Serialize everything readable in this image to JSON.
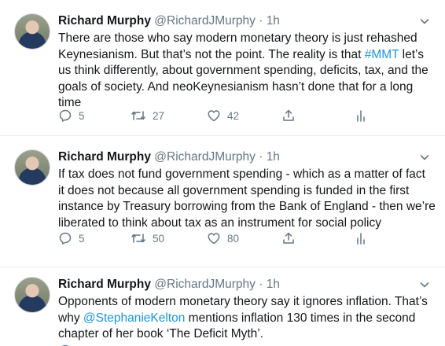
{
  "tweets": [
    {
      "author_name": "Richard Murphy",
      "handle": "@RichardJMurphy",
      "separator": "·",
      "time": "1h",
      "text_lines": [
        [
          {
            "t": "There are those who say modern monetary theory is just rehashed"
          }
        ],
        [
          {
            "t": "Keynesianism. But that’s not the point. The reality is that "
          },
          {
            "t": "#MMT",
            "link": true
          },
          {
            "t": " let’s"
          }
        ],
        [
          {
            "t": "us think differently, about government spending, deficits, tax, and the"
          }
        ],
        [
          {
            "t": "goals of society. And neoKeynesianism hasn’t done that for a long"
          }
        ],
        [
          {
            "t": "time"
          }
        ]
      ],
      "replies": "5",
      "retweets": "27",
      "likes": "42"
    },
    {
      "author_name": "Richard Murphy",
      "handle": "@RichardJMurphy",
      "separator": "·",
      "time": "1h",
      "text_lines": [
        [
          {
            "t": "If tax does not fund government spending - which as a matter of fact"
          }
        ],
        [
          {
            "t": "it does not because all government spending is funded in the first"
          }
        ],
        [
          {
            "t": "instance by Treasury borrowing from the Bank of England - then we’re"
          }
        ],
        [
          {
            "t": "liberated to think about tax as an instrument for social policy"
          }
        ]
      ],
      "replies": "5",
      "retweets": "50",
      "likes": "80"
    },
    {
      "author_name": "Richard Murphy",
      "handle": "@RichardJMurphy",
      "separator": "·",
      "time": "1h",
      "text_lines": [
        [
          {
            "t": "Opponents of modern monetary theory say it ignores inflation. That’s"
          }
        ],
        [
          {
            "t": "why "
          },
          {
            "t": "@StephanieKelton",
            "link": true
          },
          {
            "t": " mentions inflation 130 times in the second"
          }
        ],
        [
          {
            "t": "chapter of her book ‘The Deficit Myth’."
          }
        ]
      ],
      "replies": "",
      "retweets": "",
      "likes": ""
    }
  ],
  "colors": {
    "link": "#1b95e0",
    "muted": "#657786",
    "text": "#14171a",
    "divider": "#e6ecf0"
  },
  "icons": [
    "reply-icon",
    "retweet-icon",
    "like-icon",
    "share-icon",
    "analytics-icon",
    "chevron-down-icon"
  ]
}
